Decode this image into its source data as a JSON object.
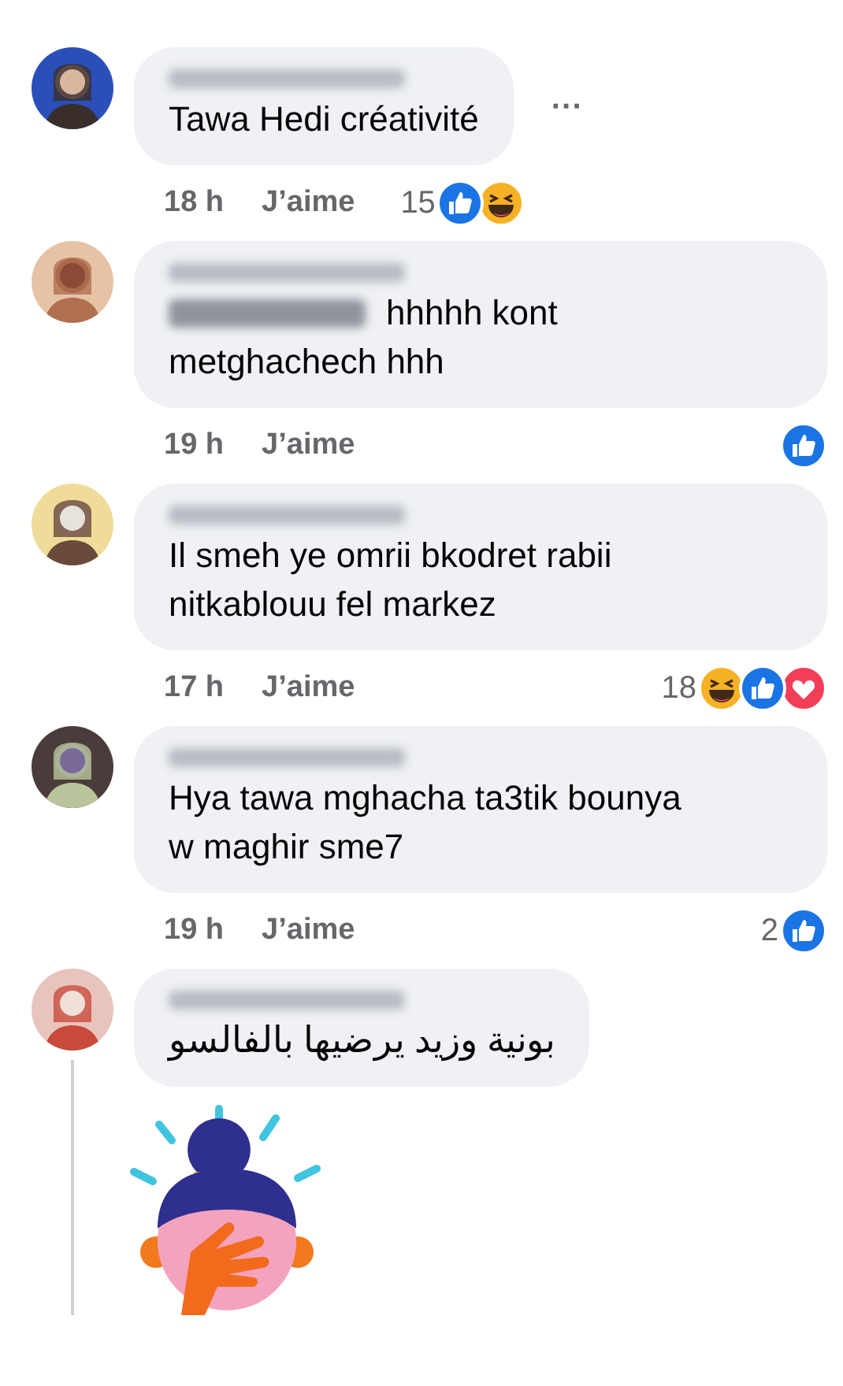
{
  "comments": [
    {
      "name_redacted": true,
      "text": "Tawa Hedi créativité",
      "more_menu": "···",
      "time": "18 h",
      "like_label": "J’aime",
      "reaction_count": "15",
      "reactions": [
        {
          "kind": "like"
        },
        {
          "kind": "haha"
        }
      ]
    },
    {
      "name_redacted": true,
      "mention_redacted": true,
      "text": "hhhhh kont metghachech hhh",
      "time": "19 h",
      "like_label": "J’aime",
      "reactions": [
        {
          "kind": "like"
        }
      ]
    },
    {
      "name_redacted": true,
      "text": "Il smeh ye omrii bkodret rabii nitkablouu fel markez",
      "time": "17 h",
      "like_label": "J’aime",
      "reaction_count": "18",
      "reactions": [
        {
          "kind": "haha"
        },
        {
          "kind": "like"
        },
        {
          "kind": "love"
        }
      ]
    },
    {
      "name_redacted": true,
      "text": "Hya tawa mghacha ta3tik bounya w maghir sme7",
      "time": "19 h",
      "like_label": "J’aime",
      "reaction_count": "2",
      "reactions": [
        {
          "kind": "like"
        }
      ]
    },
    {
      "name_redacted": true,
      "text": "بونية وزيد يرضيها بالفالسو",
      "rtl": true,
      "thread_line": true
    }
  ]
}
